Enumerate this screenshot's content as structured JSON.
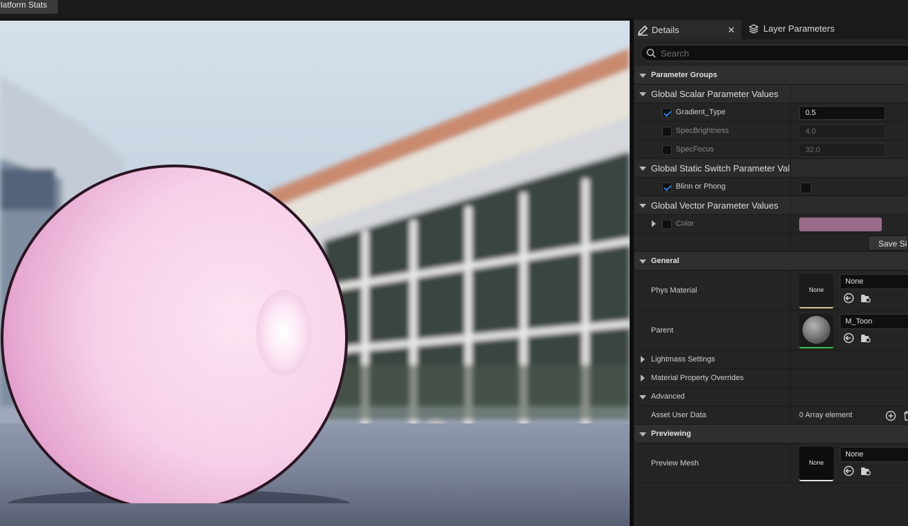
{
  "toolbar": {
    "platform_stats": "Platform Stats"
  },
  "tabs": [
    {
      "label": "Details",
      "icon": "pencil-icon"
    },
    {
      "label": "Layer Parameters",
      "icon": "layers-icon"
    }
  ],
  "search": {
    "placeholder": "Search"
  },
  "sections": {
    "parameter_groups": "Parameter Groups",
    "global_scalar": "Global Scalar Parameter Values",
    "global_static_switch": "Global Static Switch Parameter Values",
    "global_vector": "Global Vector Parameter Values",
    "general": "General",
    "lightmass": "Lightmass Settings",
    "material_overrides": "Material Property Overrides",
    "advanced": "Advanced",
    "previewing": "Previewing"
  },
  "scalar_params": [
    {
      "label": "Gradient_Type",
      "checked": true,
      "value": "0.5"
    },
    {
      "label": "SpecBrightness",
      "checked": false,
      "value": "4.0"
    },
    {
      "label": "SpecFocus",
      "checked": false,
      "value": "32.0"
    }
  ],
  "switch_params": [
    {
      "label": "Blinn or Phong",
      "checked": true,
      "value": false
    }
  ],
  "vector_params": [
    {
      "label": "Color",
      "checked": false,
      "color": "#9a6a89"
    }
  ],
  "save_button": "Save Sibling",
  "general": {
    "phys_material": {
      "label": "Phys Material",
      "thumb": "None",
      "value": "None"
    },
    "parent": {
      "label": "Parent",
      "value": "M_Toon"
    }
  },
  "advanced": {
    "asset_user_data": {
      "label": "Asset User Data",
      "value": "0 Array element"
    }
  },
  "previewing": {
    "preview_mesh": {
      "label": "Preview Mesh",
      "thumb": "None",
      "value": "None"
    }
  },
  "colors": {
    "sphere": "#f2c6e2",
    "accent_check": "#2f7fe0",
    "panel_bg": "#242424"
  }
}
